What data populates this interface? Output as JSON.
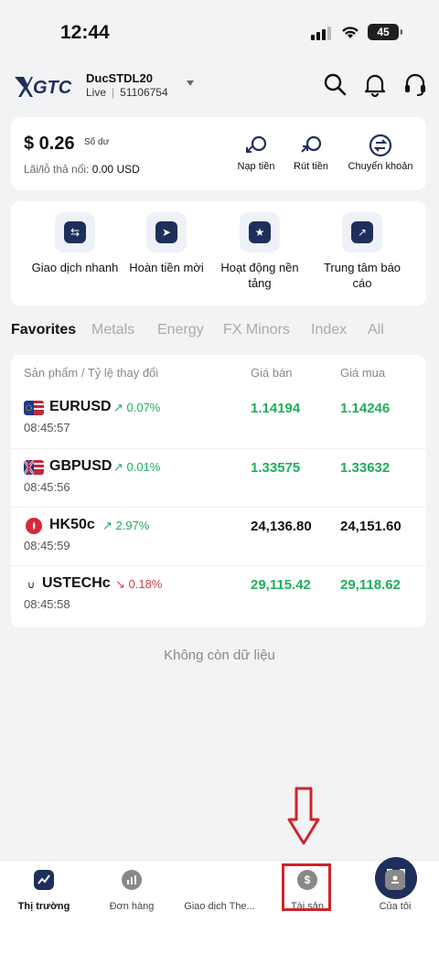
{
  "status_bar": {
    "time": "12:44",
    "battery": "45"
  },
  "header": {
    "account_name": "DucSTDL20",
    "account_mode": "Live",
    "account_id": "51106754",
    "icons": [
      "search-icon",
      "bell-icon",
      "headset-icon"
    ]
  },
  "balance": {
    "amount": "$ 0.26",
    "badge": "Số dư",
    "pnl_label": "Lãi/lỗ thả nổi:",
    "pnl_value": "0.00",
    "pnl_currency": "USD",
    "actions": [
      "Nạp tiền",
      "Rút tiền",
      "Chuyển khoản"
    ]
  },
  "features": [
    {
      "label": "Giao dịch nhanh"
    },
    {
      "label": "Hoàn tiền mời"
    },
    {
      "label": "Hoạt động nền tảng"
    },
    {
      "label": "Trung tâm báo cáo"
    }
  ],
  "tabs": [
    "Favorites",
    "Metals",
    "Energy",
    "FX Minors",
    "Index",
    "All"
  ],
  "market": {
    "headers": {
      "product": "Sản phẩm / Tỷ lệ thay đổi",
      "sell": "Giá bán",
      "buy": "Giá mua"
    },
    "rows": [
      {
        "symbol": "EURUSD",
        "change": "↗ 0.07%",
        "time": "08:45:57",
        "sell": "1.14194",
        "buy": "1.14246"
      },
      {
        "symbol": "GBPUSD",
        "change": "↗ 0.01%",
        "time": "08:45:56",
        "sell": "1.33575",
        "buy": "1.33632"
      },
      {
        "symbol": "HK50c",
        "change": "↗ 2.97%",
        "time": "08:45:59",
        "sell": "24,136.80",
        "buy": "24,151.60"
      },
      {
        "symbol": "USTECHc",
        "change": "↘ 0.18%",
        "time": "08:45:58",
        "sell": "29,115.42",
        "buy": "29,118.62"
      }
    ],
    "end_text": "Không còn dữ liệu"
  },
  "bottom_nav": [
    "Thị trường",
    "Đơn hàng",
    "Giao dịch The...",
    "Tài sản",
    "Của tôi"
  ],
  "colors": {
    "accent": "#1e2f5c",
    "up": "#1fae5c",
    "down": "#d63b4a",
    "annotation": "#d0232c"
  }
}
